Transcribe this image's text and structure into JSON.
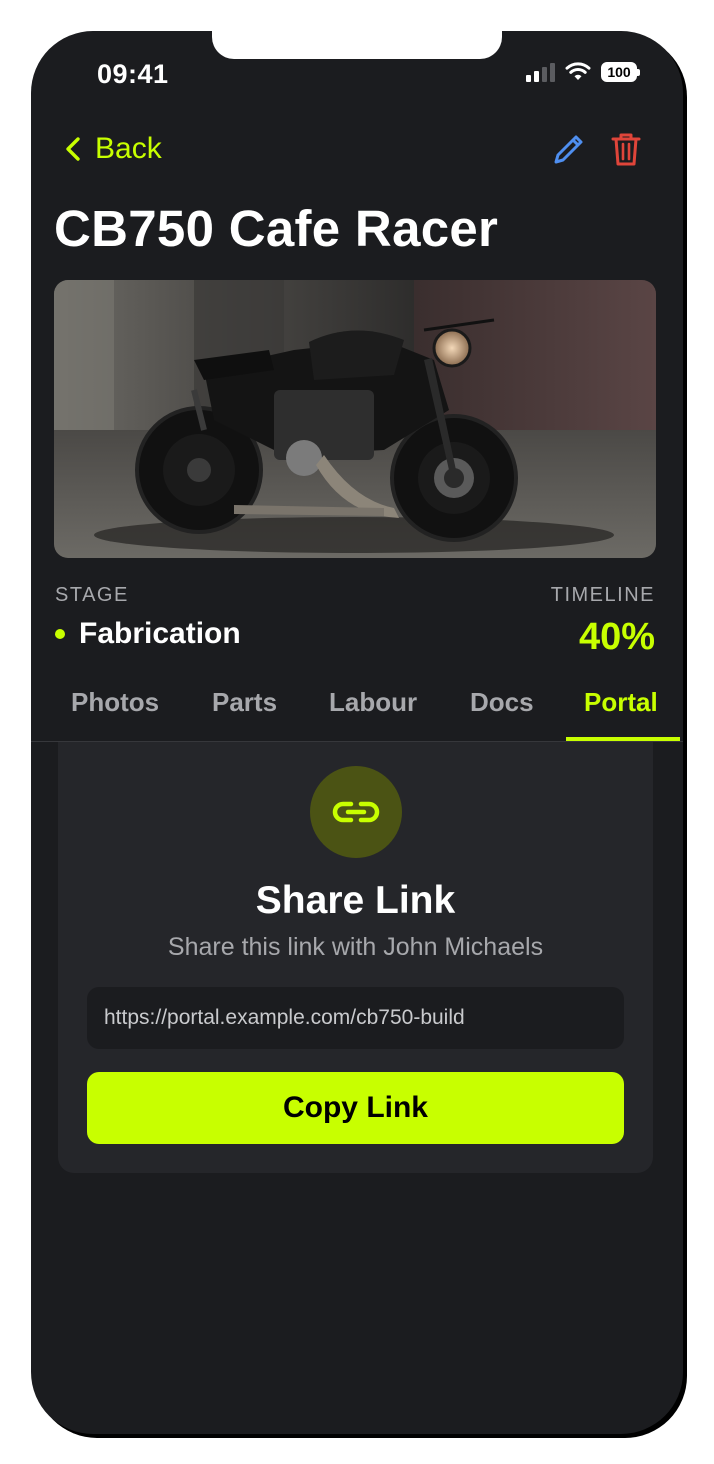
{
  "status_bar": {
    "time": "09:41",
    "battery": "100"
  },
  "nav": {
    "back_label": "Back",
    "edit_icon": "pencil-icon",
    "delete_icon": "trash-icon"
  },
  "project": {
    "title": "CB750 Cafe Racer",
    "image_alt": "black cafe racer motorcycle",
    "stage_label": "STAGE",
    "stage_value": "Fabrication",
    "timeline_label": "TIMELINE",
    "timeline_value": "40%",
    "timeline_progress": 0.4
  },
  "tabs": [
    {
      "label": "Photos",
      "active": false
    },
    {
      "label": "Parts",
      "active": false
    },
    {
      "label": "Labour",
      "active": false
    },
    {
      "label": "Docs",
      "active": false
    },
    {
      "label": "Portal",
      "active": true
    }
  ],
  "portal": {
    "icon": "link-icon",
    "title": "Share Link",
    "subtitle": "Share this link with John Michaels",
    "url": "https://portal.example.com/cb750-build",
    "copy_label": "Copy Link"
  },
  "colors": {
    "accent": "#c8ff00",
    "background": "#1b1c1f",
    "card": "#25262a",
    "danger": "#e0453a",
    "edit": "#4f8ff0"
  }
}
